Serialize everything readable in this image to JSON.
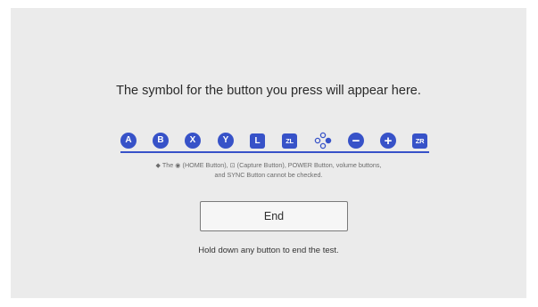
{
  "prompt": "The symbol for the button you press will appear here.",
  "buttons": [
    {
      "name": "a-button-icon",
      "label": "A",
      "shape": "round"
    },
    {
      "name": "b-button-icon",
      "label": "B",
      "shape": "round"
    },
    {
      "name": "x-button-icon",
      "label": "X",
      "shape": "round"
    },
    {
      "name": "y-button-icon",
      "label": "Y",
      "shape": "round"
    },
    {
      "name": "l-button-icon",
      "label": "L",
      "shape": "square"
    },
    {
      "name": "zl-button-icon",
      "label": "ZL",
      "shape": "square"
    },
    {
      "name": "dpad-icon",
      "label": "",
      "shape": "dpad"
    },
    {
      "name": "minus-button-icon",
      "label": "−",
      "shape": "round"
    },
    {
      "name": "plus-button-icon",
      "label": "+",
      "shape": "round"
    },
    {
      "name": "zr-button-icon",
      "label": "ZR",
      "shape": "square"
    }
  ],
  "note": {
    "line1": "◆ The ◉ (HOME Button), ⊡ (Capture Button), POWER Button, volume buttons,",
    "line2": "and SYNC Button cannot be checked."
  },
  "end_button": {
    "label": "End"
  },
  "hint": "Hold down any button to end the test.",
  "colors": {
    "accent": "#3752c8",
    "background": "#ebebeb",
    "page": "#ffffff"
  }
}
